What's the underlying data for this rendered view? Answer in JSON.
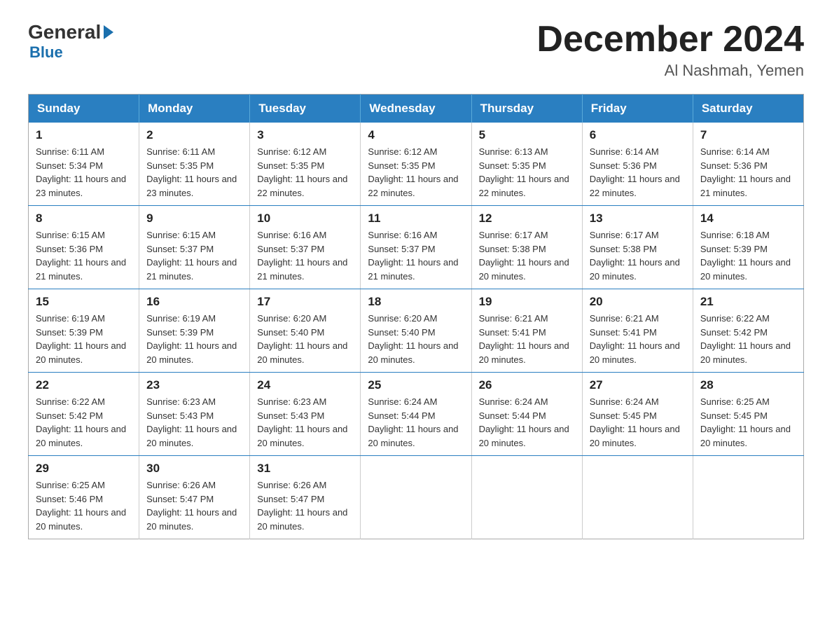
{
  "header": {
    "logo_general": "General",
    "logo_blue": "Blue",
    "month_title": "December 2024",
    "location": "Al Nashmah, Yemen"
  },
  "days_of_week": [
    "Sunday",
    "Monday",
    "Tuesday",
    "Wednesday",
    "Thursday",
    "Friday",
    "Saturday"
  ],
  "weeks": [
    [
      {
        "day": "1",
        "sunrise": "Sunrise: 6:11 AM",
        "sunset": "Sunset: 5:34 PM",
        "daylight": "Daylight: 11 hours and 23 minutes."
      },
      {
        "day": "2",
        "sunrise": "Sunrise: 6:11 AM",
        "sunset": "Sunset: 5:35 PM",
        "daylight": "Daylight: 11 hours and 23 minutes."
      },
      {
        "day": "3",
        "sunrise": "Sunrise: 6:12 AM",
        "sunset": "Sunset: 5:35 PM",
        "daylight": "Daylight: 11 hours and 22 minutes."
      },
      {
        "day": "4",
        "sunrise": "Sunrise: 6:12 AM",
        "sunset": "Sunset: 5:35 PM",
        "daylight": "Daylight: 11 hours and 22 minutes."
      },
      {
        "day": "5",
        "sunrise": "Sunrise: 6:13 AM",
        "sunset": "Sunset: 5:35 PM",
        "daylight": "Daylight: 11 hours and 22 minutes."
      },
      {
        "day": "6",
        "sunrise": "Sunrise: 6:14 AM",
        "sunset": "Sunset: 5:36 PM",
        "daylight": "Daylight: 11 hours and 22 minutes."
      },
      {
        "day": "7",
        "sunrise": "Sunrise: 6:14 AM",
        "sunset": "Sunset: 5:36 PM",
        "daylight": "Daylight: 11 hours and 21 minutes."
      }
    ],
    [
      {
        "day": "8",
        "sunrise": "Sunrise: 6:15 AM",
        "sunset": "Sunset: 5:36 PM",
        "daylight": "Daylight: 11 hours and 21 minutes."
      },
      {
        "day": "9",
        "sunrise": "Sunrise: 6:15 AM",
        "sunset": "Sunset: 5:37 PM",
        "daylight": "Daylight: 11 hours and 21 minutes."
      },
      {
        "day": "10",
        "sunrise": "Sunrise: 6:16 AM",
        "sunset": "Sunset: 5:37 PM",
        "daylight": "Daylight: 11 hours and 21 minutes."
      },
      {
        "day": "11",
        "sunrise": "Sunrise: 6:16 AM",
        "sunset": "Sunset: 5:37 PM",
        "daylight": "Daylight: 11 hours and 21 minutes."
      },
      {
        "day": "12",
        "sunrise": "Sunrise: 6:17 AM",
        "sunset": "Sunset: 5:38 PM",
        "daylight": "Daylight: 11 hours and 20 minutes."
      },
      {
        "day": "13",
        "sunrise": "Sunrise: 6:17 AM",
        "sunset": "Sunset: 5:38 PM",
        "daylight": "Daylight: 11 hours and 20 minutes."
      },
      {
        "day": "14",
        "sunrise": "Sunrise: 6:18 AM",
        "sunset": "Sunset: 5:39 PM",
        "daylight": "Daylight: 11 hours and 20 minutes."
      }
    ],
    [
      {
        "day": "15",
        "sunrise": "Sunrise: 6:19 AM",
        "sunset": "Sunset: 5:39 PM",
        "daylight": "Daylight: 11 hours and 20 minutes."
      },
      {
        "day": "16",
        "sunrise": "Sunrise: 6:19 AM",
        "sunset": "Sunset: 5:39 PM",
        "daylight": "Daylight: 11 hours and 20 minutes."
      },
      {
        "day": "17",
        "sunrise": "Sunrise: 6:20 AM",
        "sunset": "Sunset: 5:40 PM",
        "daylight": "Daylight: 11 hours and 20 minutes."
      },
      {
        "day": "18",
        "sunrise": "Sunrise: 6:20 AM",
        "sunset": "Sunset: 5:40 PM",
        "daylight": "Daylight: 11 hours and 20 minutes."
      },
      {
        "day": "19",
        "sunrise": "Sunrise: 6:21 AM",
        "sunset": "Sunset: 5:41 PM",
        "daylight": "Daylight: 11 hours and 20 minutes."
      },
      {
        "day": "20",
        "sunrise": "Sunrise: 6:21 AM",
        "sunset": "Sunset: 5:41 PM",
        "daylight": "Daylight: 11 hours and 20 minutes."
      },
      {
        "day": "21",
        "sunrise": "Sunrise: 6:22 AM",
        "sunset": "Sunset: 5:42 PM",
        "daylight": "Daylight: 11 hours and 20 minutes."
      }
    ],
    [
      {
        "day": "22",
        "sunrise": "Sunrise: 6:22 AM",
        "sunset": "Sunset: 5:42 PM",
        "daylight": "Daylight: 11 hours and 20 minutes."
      },
      {
        "day": "23",
        "sunrise": "Sunrise: 6:23 AM",
        "sunset": "Sunset: 5:43 PM",
        "daylight": "Daylight: 11 hours and 20 minutes."
      },
      {
        "day": "24",
        "sunrise": "Sunrise: 6:23 AM",
        "sunset": "Sunset: 5:43 PM",
        "daylight": "Daylight: 11 hours and 20 minutes."
      },
      {
        "day": "25",
        "sunrise": "Sunrise: 6:24 AM",
        "sunset": "Sunset: 5:44 PM",
        "daylight": "Daylight: 11 hours and 20 minutes."
      },
      {
        "day": "26",
        "sunrise": "Sunrise: 6:24 AM",
        "sunset": "Sunset: 5:44 PM",
        "daylight": "Daylight: 11 hours and 20 minutes."
      },
      {
        "day": "27",
        "sunrise": "Sunrise: 6:24 AM",
        "sunset": "Sunset: 5:45 PM",
        "daylight": "Daylight: 11 hours and 20 minutes."
      },
      {
        "day": "28",
        "sunrise": "Sunrise: 6:25 AM",
        "sunset": "Sunset: 5:45 PM",
        "daylight": "Daylight: 11 hours and 20 minutes."
      }
    ],
    [
      {
        "day": "29",
        "sunrise": "Sunrise: 6:25 AM",
        "sunset": "Sunset: 5:46 PM",
        "daylight": "Daylight: 11 hours and 20 minutes."
      },
      {
        "day": "30",
        "sunrise": "Sunrise: 6:26 AM",
        "sunset": "Sunset: 5:47 PM",
        "daylight": "Daylight: 11 hours and 20 minutes."
      },
      {
        "day": "31",
        "sunrise": "Sunrise: 6:26 AM",
        "sunset": "Sunset: 5:47 PM",
        "daylight": "Daylight: 11 hours and 20 minutes."
      },
      null,
      null,
      null,
      null
    ]
  ]
}
